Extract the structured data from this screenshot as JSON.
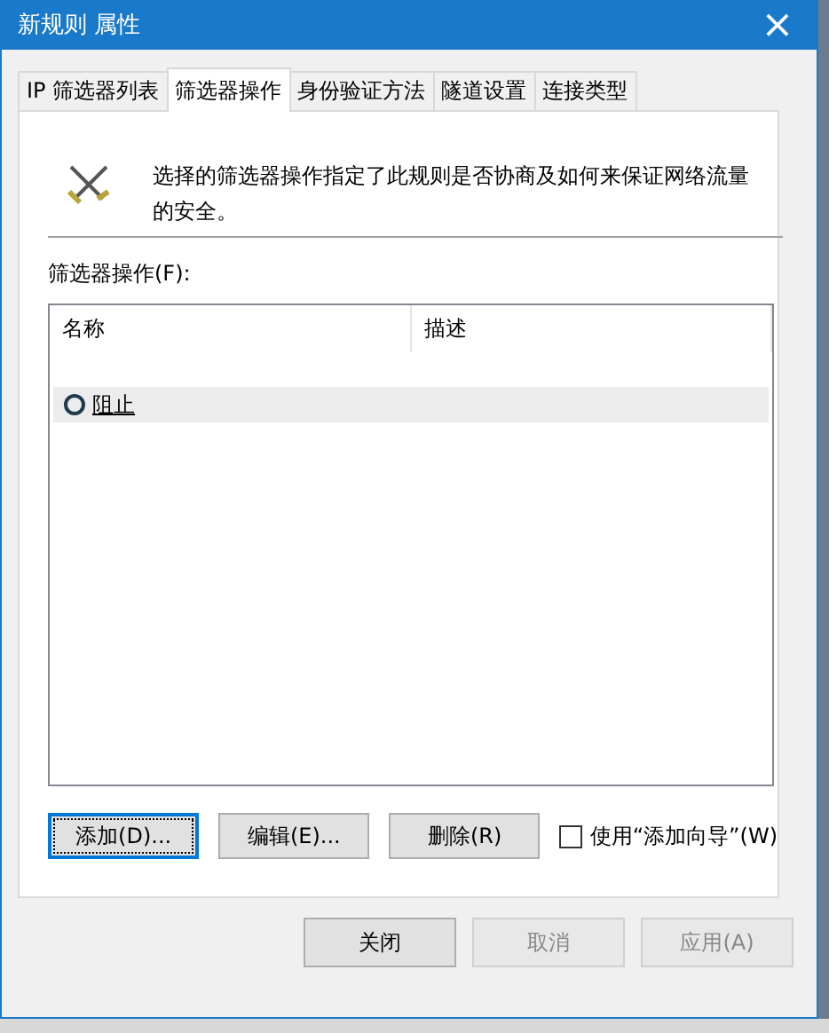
{
  "window": {
    "title": "新规则 属性",
    "close": "×"
  },
  "tabs": [
    {
      "label": "IP 筛选器列表",
      "selected": false
    },
    {
      "label": "筛选器操作",
      "selected": true
    },
    {
      "label": "身份验证方法",
      "selected": false
    },
    {
      "label": "隧道设置",
      "selected": false
    },
    {
      "label": "连接类型",
      "selected": false
    }
  ],
  "description": "选择的筛选器操作指定了此规则是否协商及如何来保证网络流量的安全。",
  "list_label": "筛选器操作(F):",
  "table": {
    "columns": [
      "名称",
      "描述"
    ],
    "rows": [
      {
        "name": "阻止",
        "description": "",
        "selected": true,
        "checked": false
      }
    ]
  },
  "actions": [
    {
      "label": "添加(D)...",
      "focused": true
    },
    {
      "label": "编辑(E)...",
      "focused": false
    },
    {
      "label": "删除(R)",
      "focused": false
    }
  ],
  "wizard": {
    "label": "使用“添加向导”(W)",
    "checked": false
  },
  "buttons": [
    {
      "label": "关闭",
      "disabled": false
    },
    {
      "label": "取消",
      "disabled": true
    },
    {
      "label": "应用(A)",
      "disabled": true
    }
  ]
}
